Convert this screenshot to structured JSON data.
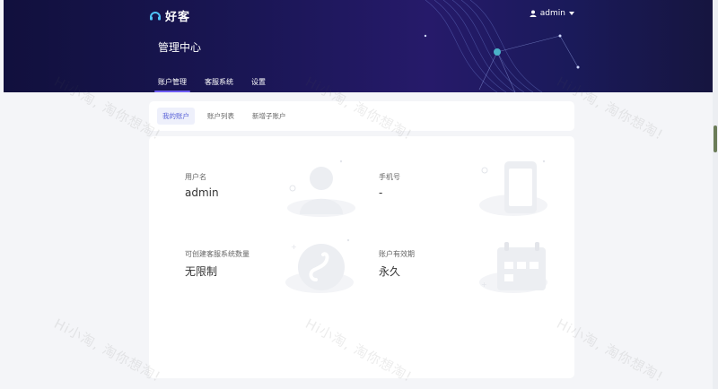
{
  "header": {
    "logo_text": "好客",
    "user_name": "admin",
    "page_title": "管理中心",
    "tabs": [
      {
        "label": "账户管理",
        "active": true
      },
      {
        "label": "客服系统",
        "active": false
      },
      {
        "label": "设置",
        "active": false
      }
    ]
  },
  "subtabs": [
    {
      "label": "我的账户",
      "active": true
    },
    {
      "label": "账户列表",
      "active": false
    },
    {
      "label": "新增子账户",
      "active": false
    }
  ],
  "account": {
    "username_label": "用户名",
    "username_value": "admin",
    "phone_label": "手机号",
    "phone_value": "-",
    "quota_label": "可创建客服系统数量",
    "quota_value": "无限制",
    "expiry_label": "账户有效期",
    "expiry_value": "永久"
  },
  "watermark": {
    "text": "Hi小淘, 淘你想淘!"
  },
  "icons": [
    "headset-logo-icon",
    "user-icon",
    "caret-down-icon",
    "avatar-illustration-icon",
    "phone-illustration-icon",
    "app-illustration-icon",
    "calendar-illustration-icon"
  ],
  "colors": {
    "header_bg": "#1a1655",
    "accent": "#6d5cf4",
    "subtab_active": "#5b63d8",
    "page_bg": "#f4f5f8"
  }
}
